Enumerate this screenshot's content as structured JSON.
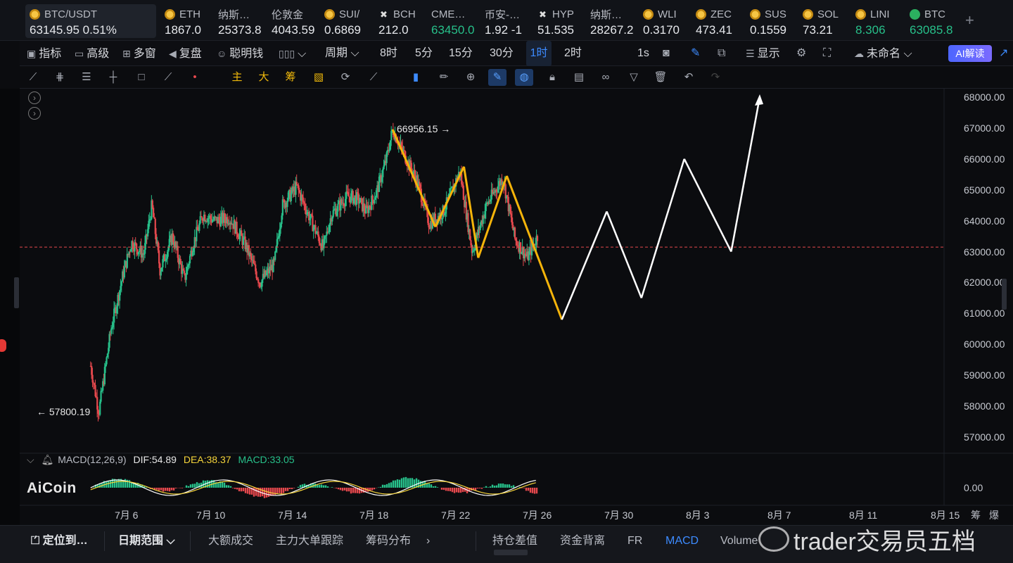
{
  "ticker": [
    {
      "name": "BTC/USDT",
      "price": "63145.95  0.51%",
      "icon": "bitcoin-coin-icon",
      "dir": "dn"
    },
    {
      "name": "ETH",
      "price": "1867.0",
      "icon": "coin-icon",
      "dir": "dn"
    },
    {
      "name": "纳斯…",
      "price": "25373.8",
      "icon": "",
      "dir": "dn"
    },
    {
      "name": "伦敦金",
      "price": "4043.59",
      "icon": "",
      "dir": "dn"
    },
    {
      "name": "SUI/",
      "price": "0.6869",
      "icon": "coin-icon",
      "dir": "dn"
    },
    {
      "name": "BCH",
      "price": "212.0",
      "icon": "x-icon",
      "dir": "dn"
    },
    {
      "name": "CME…",
      "price": "63450.0",
      "icon": "",
      "dir": "up"
    },
    {
      "name": "币安-…",
      "price": "1.92 -1",
      "icon": "",
      "dir": "dn"
    },
    {
      "name": "HYP",
      "price": "51.535",
      "icon": "x-icon",
      "dir": "dn"
    },
    {
      "name": "纳斯…",
      "price": "28267.2",
      "icon": "",
      "dir": "dn"
    },
    {
      "name": "WLI",
      "price": "0.3170",
      "icon": "coin-icon",
      "dir": "dn"
    },
    {
      "name": "ZEC",
      "price": "473.41",
      "icon": "coin-icon",
      "dir": "dn"
    },
    {
      "name": "SUS",
      "price": "0.1559",
      "icon": "coin-icon",
      "dir": "dn"
    },
    {
      "name": "SOL",
      "price": "73.21",
      "icon": "coin-icon",
      "dir": "dn"
    },
    {
      "name": "LINI",
      "price": "8.306",
      "icon": "coin-icon",
      "dir": "up"
    },
    {
      "name": "BTC",
      "price": "63085.8",
      "icon": "bitcoin-green-icon",
      "dir": "up"
    }
  ],
  "toolbar1": {
    "indicators": "指标",
    "advanced": "高级",
    "multi": "多窗",
    "replay": "复盘",
    "smart_money": "聪明钱",
    "period": "周期",
    "p8h": "8时",
    "p5m": "5分",
    "p15m": "15分",
    "p30m": "30分",
    "p1h": "1时",
    "p2h": "2时",
    "p1s": "1s",
    "display": "显示",
    "unnamed": "未命名",
    "ai": "AI解读"
  },
  "toolbar2": {
    "main": "主",
    "big": "大",
    "chips": "筹"
  },
  "annotations": {
    "high": "66956.15",
    "low": "57800.19"
  },
  "y_axis": [
    "68000.00",
    "67000.00",
    "66000.00",
    "65000.00",
    "64000.00",
    "63000.00",
    "62000.00",
    "61000.00",
    "60000.00",
    "59000.00",
    "58000.00",
    "57000.00"
  ],
  "x_axis": [
    "7月 6",
    "7月 10",
    "7月 14",
    "7月 18",
    "7月 22",
    "7月 26",
    "7月 30",
    "8月 3",
    "8月 7",
    "8月 11",
    "8月 15"
  ],
  "macd": {
    "label": "MACD(12,26,9)",
    "dif": "DIF:54.89",
    "dea": "DEA:38.37",
    "macd": "MACD:33.05",
    "zero": "0.00"
  },
  "logo": "AiCoin",
  "right_labels": {
    "chips": "筹",
    "burst": "爆"
  },
  "bottom": {
    "locate": "定位到…",
    "date_range": "日期范围",
    "big_trades": "大额成交",
    "main_force": "主力大单跟踪",
    "chip_dist": "筹码分布",
    "oi_diff": "持仓差值",
    "fund_div": "资金背离",
    "fr": "FR",
    "macd": "MACD",
    "volume": "Volume"
  },
  "watermark": "trader交易员五档",
  "colors": {
    "up": "#27c08a",
    "down": "#e5484d",
    "accent": "#3d8bff",
    "wave_yellow": "#f5b40a",
    "projection": "#ffffff",
    "current_price_line": "#e5484d"
  },
  "chart_data": {
    "type": "candlestick",
    "symbol": "BTC/USDT",
    "interval": "1时",
    "ylim": [
      56500,
      68300
    ],
    "current_price": 63145.95,
    "marked_high": 66956.15,
    "marked_low": 57800.19,
    "x_ticks": [
      "7月 6",
      "7月 10",
      "7月 14",
      "7月 18",
      "7月 22",
      "7月 26",
      "7月 30",
      "8月 3",
      "8月 7",
      "8月 11",
      "8月 15"
    ],
    "price_path": [
      {
        "d": 4.2,
        "p": 59300
      },
      {
        "d": 4.6,
        "p": 57800
      },
      {
        "d": 5.2,
        "p": 60500
      },
      {
        "d": 5.8,
        "p": 62300
      },
      {
        "d": 6.2,
        "p": 63300
      },
      {
        "d": 6.8,
        "p": 62900
      },
      {
        "d": 7.2,
        "p": 64500
      },
      {
        "d": 7.6,
        "p": 62400
      },
      {
        "d": 8.2,
        "p": 63500
      },
      {
        "d": 8.8,
        "p": 62100
      },
      {
        "d": 9.2,
        "p": 63200
      },
      {
        "d": 9.7,
        "p": 64200
      },
      {
        "d": 10.3,
        "p": 64000
      },
      {
        "d": 11.0,
        "p": 64100
      },
      {
        "d": 11.8,
        "p": 63200
      },
      {
        "d": 12.5,
        "p": 62000
      },
      {
        "d": 13.2,
        "p": 62600
      },
      {
        "d": 13.6,
        "p": 64500
      },
      {
        "d": 14.3,
        "p": 65100
      },
      {
        "d": 15.0,
        "p": 64000
      },
      {
        "d": 15.6,
        "p": 63100
      },
      {
        "d": 16.0,
        "p": 64200
      },
      {
        "d": 16.8,
        "p": 64800
      },
      {
        "d": 17.3,
        "p": 64700
      },
      {
        "d": 17.7,
        "p": 64300
      },
      {
        "d": 18.2,
        "p": 64900
      },
      {
        "d": 18.7,
        "p": 66000
      },
      {
        "d": 19.0,
        "p": 66956
      },
      {
        "d": 19.6,
        "p": 66100
      },
      {
        "d": 20.2,
        "p": 65300
      },
      {
        "d": 20.8,
        "p": 63900
      },
      {
        "d": 21.5,
        "p": 64300
      },
      {
        "d": 22.3,
        "p": 65600
      },
      {
        "d": 22.9,
        "p": 63000
      },
      {
        "d": 23.6,
        "p": 64500
      },
      {
        "d": 24.4,
        "p": 65400
      },
      {
        "d": 25.0,
        "p": 63400
      },
      {
        "d": 25.6,
        "p": 62800
      },
      {
        "d": 26.1,
        "p": 63500
      }
    ],
    "wave_points": [
      {
        "d": 19.0,
        "p": 66956
      },
      {
        "d": 21.1,
        "p": 63800
      },
      {
        "d": 22.5,
        "p": 65750
      },
      {
        "d": 23.2,
        "p": 62800
      },
      {
        "d": 24.6,
        "p": 65450
      },
      {
        "d": 27.3,
        "p": 60800
      }
    ],
    "projection_points": [
      {
        "d": 27.3,
        "p": 60800
      },
      {
        "d": 29.5,
        "p": 64300
      },
      {
        "d": 31.2,
        "p": 61500
      },
      {
        "d": 33.3,
        "p": 66000
      },
      {
        "d": 35.6,
        "p": 63000
      },
      {
        "d": 37.0,
        "p": 68000
      }
    ],
    "macd": {
      "fast": 12,
      "slow": 26,
      "signal": 9,
      "dif": 54.89,
      "dea": 38.37,
      "hist": 33.05
    }
  }
}
